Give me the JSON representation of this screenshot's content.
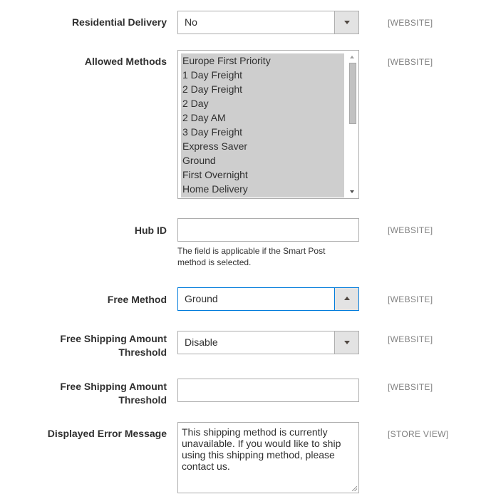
{
  "fields": {
    "residential_delivery": {
      "label": "Residential Delivery",
      "value": "No",
      "scope": "[WEBSITE]"
    },
    "allowed_methods": {
      "label": "Allowed Methods",
      "scope": "[WEBSITE]",
      "options": [
        "Europe First Priority",
        "1 Day Freight",
        "2 Day Freight",
        "2 Day",
        "2 Day AM",
        "3 Day Freight",
        "Express Saver",
        "Ground",
        "First Overnight",
        "Home Delivery"
      ]
    },
    "hub_id": {
      "label": "Hub ID",
      "value": "",
      "scope": "[WEBSITE]",
      "note": "The field is applicable if the Smart Post method is selected."
    },
    "free_method": {
      "label": "Free Method",
      "value": "Ground",
      "scope": "[WEBSITE]"
    },
    "free_shipping_threshold_enable": {
      "label": "Free Shipping Amount Threshold",
      "value": "Disable",
      "scope": "[WEBSITE]"
    },
    "free_shipping_threshold": {
      "label": "Free Shipping Amount Threshold",
      "value": "",
      "scope": "[WEBSITE]"
    },
    "displayed_error_message": {
      "label": "Displayed Error Message",
      "value": "This shipping method is currently unavailable. If you would like to ship using this shipping method, please contact us.",
      "scope": "[STORE VIEW]"
    }
  },
  "colors": {
    "focus_border": "#007bdb",
    "scope_text": "#808080",
    "selected_option_bg": "#cecece"
  }
}
